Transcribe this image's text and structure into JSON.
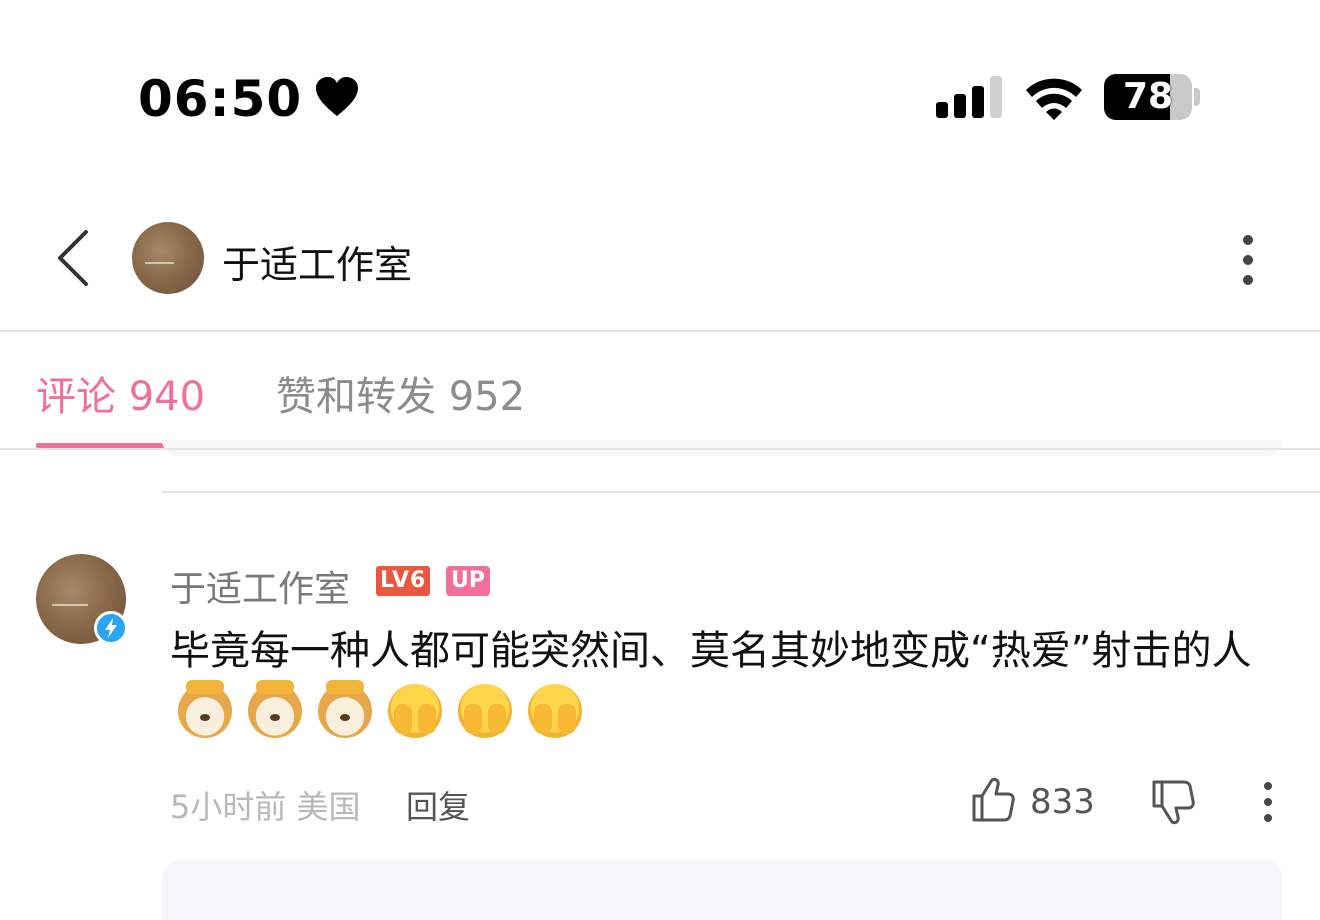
{
  "status_bar": {
    "time": "06:50",
    "battery": "78",
    "icons": [
      "heart-icon",
      "signal-icon",
      "wifi-icon",
      "battery-icon"
    ]
  },
  "header": {
    "title": "于适工作室",
    "icons": [
      "back-icon",
      "more-icon"
    ]
  },
  "tabs": [
    {
      "label": "评论 940",
      "active": true
    },
    {
      "label": "赞和转发 952",
      "active": false
    }
  ],
  "comment": {
    "author": "于适工作室",
    "level": "LV6",
    "badge": "UP",
    "text": "毕竟每一种人都可能突然间、莫名其妙地变成“热爱”射击的人",
    "emojis": [
      "doge",
      "doge",
      "doge",
      "facepalm",
      "facepalm",
      "facepalm"
    ],
    "time_location": "5小时前 美国",
    "reply_label": "回复",
    "like_count": "833"
  },
  "colors": {
    "accent": "#f0709a",
    "level_badge": "#e9573f",
    "verified": "#2aa5f5",
    "muted_text": "#8c8c8c"
  }
}
